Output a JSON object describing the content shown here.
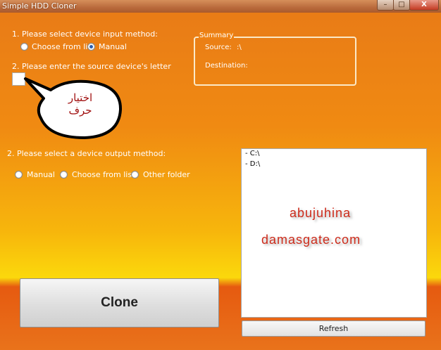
{
  "window": {
    "title": "Simple HDD Cloner",
    "controls": {
      "minimize": "–",
      "maximize": "□",
      "close": "X"
    }
  },
  "input_section": {
    "heading": "1. Please select device input method:",
    "options": [
      {
        "label": "Choose from list",
        "selected": false
      },
      {
        "label": "Manual",
        "selected": true
      }
    ],
    "letter_prompt": "2. Please enter the source device's letter",
    "letter_value": ""
  },
  "callout": {
    "line1": "اختيار",
    "line2": "حرف"
  },
  "summary": {
    "legend": "Summary",
    "source_label": "Source:",
    "source_value": ":\\",
    "destination_label": "Destination:",
    "destination_value": ""
  },
  "output_section": {
    "heading": "2. Please select a device output method:",
    "options": [
      {
        "label": "Manual",
        "selected": false
      },
      {
        "label": "Choose from list",
        "selected": false
      },
      {
        "label": "Other folder",
        "selected": false
      }
    ]
  },
  "drive_list": {
    "items": [
      "- C:\\",
      "- D:\\"
    ]
  },
  "watermark": {
    "line1": "abujuhina",
    "line2": "damasgate.com"
  },
  "buttons": {
    "clone": "Clone",
    "refresh": "Refresh"
  }
}
